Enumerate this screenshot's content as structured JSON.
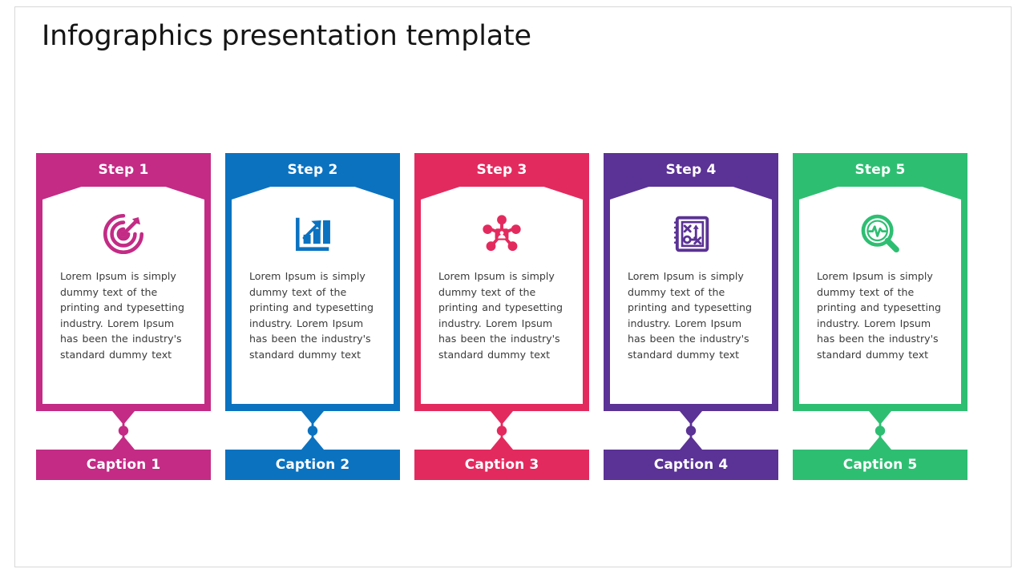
{
  "slide": {
    "title": "Infographics presentation template",
    "background_color": "#ffffff",
    "border_color": "#d8d8d8"
  },
  "body_text": "Lorem Ipsum is simply dummy text of the printing and typesetting industry. Lorem Ipsum has been the industry's standard dummy text",
  "columns": [
    {
      "step_label": "Step 1",
      "caption_label": "Caption 1",
      "color": "#C32B85",
      "icon": "target-arrow-icon",
      "body": "Lorem Ipsum is simply dummy text of the printing and typesetting industry. Lorem Ipsum has been the industry's standard dummy text"
    },
    {
      "step_label": "Step 2",
      "caption_label": "Caption 2",
      "color": "#0B72C0",
      "icon": "bar-chart-growth-icon",
      "body": "Lorem Ipsum is simply dummy text of the printing and typesetting industry. Lorem Ipsum has been the industry's standard dummy text"
    },
    {
      "step_label": "Step 3",
      "caption_label": "Caption 3",
      "color": "#E32A5E",
      "icon": "network-hub-icon",
      "body": "Lorem Ipsum is simply dummy text of the printing and typesetting industry. Lorem Ipsum has been the industry's standard dummy text"
    },
    {
      "step_label": "Step 4",
      "caption_label": "Caption 4",
      "color": "#5B3295",
      "icon": "strategy-playbook-icon",
      "body": "Lorem Ipsum is simply dummy text of the printing and typesetting industry. Lorem Ipsum has been the industry's standard dummy text"
    },
    {
      "step_label": "Step 5",
      "caption_label": "Caption 5",
      "color": "#2EBE72",
      "icon": "magnifier-pulse-icon",
      "body": "Lorem Ipsum is simply dummy text of the printing and typesetting industry. Lorem Ipsum has been the industry's standard dummy text"
    }
  ]
}
